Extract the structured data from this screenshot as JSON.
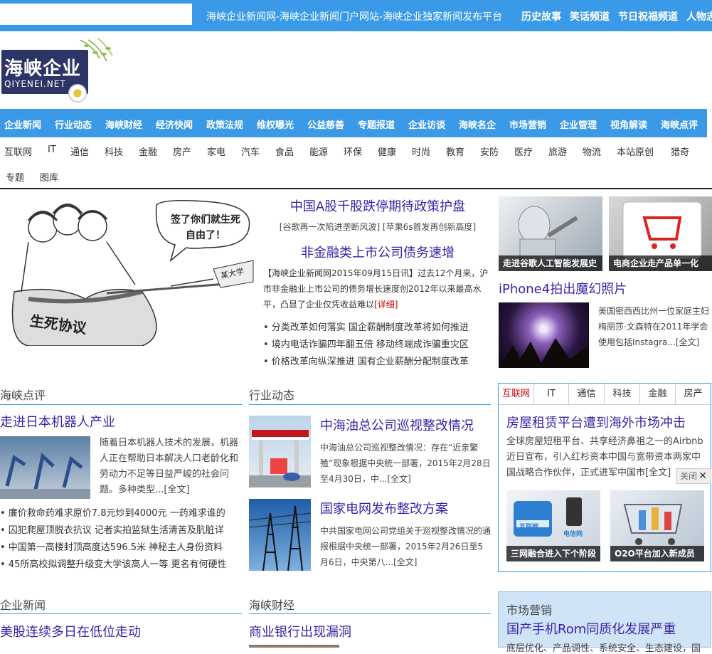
{
  "topbar": {
    "search_placeholder": "",
    "site_title": "海峡企业新闻网-海峡企业新闻门户网站-海峡企业独家新闻发布平台",
    "links": [
      "历史故事",
      "笑话频道",
      "节日祝福频道",
      "人物志"
    ]
  },
  "logo": {
    "cn": "海峡企业",
    "en": "QIYENEI.NET"
  },
  "mainnav": [
    "企业新闻",
    "行业动态",
    "海峡财经",
    "经济快闻",
    "政策法规",
    "维权曝光",
    "公益慈善",
    "专题报道",
    "企业访谈",
    "海峡名企",
    "市场营销",
    "企业管理",
    "视角解读",
    "海峡点评"
  ],
  "subnav": [
    "互联网",
    "IT",
    "通信",
    "科技",
    "金融",
    "房产",
    "家电",
    "汽车",
    "食品",
    "能源",
    "环保",
    "健康",
    "时尚",
    "教育",
    "安防",
    "医疗",
    "旅游",
    "物流",
    "本站原创",
    "猎奇",
    "专题",
    "图库"
  ],
  "cartoon": {
    "bubble": "签了你们就生死自由了！",
    "bag": "生死协议",
    "sign": "某大学"
  },
  "headline": {
    "title": "中国A股千股跌停期待政策护盘",
    "sub": "[谷歌再一次陷进垄断风波] [苹果6s首发再创新高度]",
    "title2": "非金融类上市公司债务速增",
    "body": "【海峡企业新闻网2015年09月15日讯】过去12个月来，沪市非金融业上市公司的债务增长速度创2012年以来最高水平，凸显了企业仅凭收益难以",
    "detail": "[详细]",
    "bullets": [
      "• 分类改革如何落实 国企薪酬制度改革将如何推进",
      "• 境内电话诈骗四年翻五倍 移动终端成诈骗重灾区",
      "• 价格改革向纵深推进 国有企业薪酬分配制度改革"
    ]
  },
  "right_top": {
    "cap1": "走进谷歌人工智能发展史",
    "cap2": "电商企业走产品单一化",
    "title": "iPhone4拍出魔幻照片",
    "text": "美国密西西比州一位家庭主妇梅丽莎·文森特在2011年学会使用包括Instagra...[全文]"
  },
  "haixia_dianping": {
    "section": "海峡点评",
    "title": "走进日本机器人产业",
    "text": "随着日本机器人技术的发展，机器人正在帮助日本解决人口老龄化和劳动力不足等日益严峻的社会问题。多种类型...[全文]",
    "list": [
      "• 廉价救命药难求原价7.8元炒到4000元 一药难求谁的",
      "• 囚犯爬屋顶脱衣抗议 记者实拍监狱生活清苦及肮脏详",
      "• 中国第一高楼封顶高度达596.5米 神秘主人身份资料",
      "• 45所高校拟调整升级变大学该高人一等 更名有何硬性"
    ]
  },
  "hangye": {
    "section": "行业动态",
    "a1_title": "中海油总公司巡视整改情况",
    "a1_text": "中海油总公司巡视整改情况：存在“近亲繁殖”现象根据中央统一部署，2015年2月28日至4月30日，中...[全文]",
    "a2_title": "国家电网发布整改方案",
    "a2_text": "中共国家电网公司党组关于巡视整改情况的通报根据中央统一部署，2015年2月26日至5月6日，中央第八...[全文]"
  },
  "tabbox": {
    "tabs": [
      "互联网",
      "IT",
      "通信",
      "科技",
      "金融",
      "房产"
    ],
    "title": "房屋租赁平台遭到海外市场冲击",
    "text": "全球房屋短租平台、共享经济鼻祖之一的Airbnb近日宣布，引入红杉资本中国与宽带资本两家中国战略合作伙伴，正式进军中国市[全文]",
    "cap1": "三网融合进入下个阶段",
    "cap2": "O2O平台加入新成员",
    "close": "关闭",
    "img1_label": "互联网",
    "img1_label2": "电信网"
  },
  "bottom": {
    "qiye_section": "企业新闻",
    "qiye_title": "美股连续多日在低位走动",
    "caijing_section": "海峡财经",
    "caijing_title": "商业银行出现漏洞",
    "market_section": "市场营销",
    "market_title": "国产手机Rom同质化发展严重",
    "market_sub": "底层优化、产品调性、系统安全、生态建设，国"
  }
}
